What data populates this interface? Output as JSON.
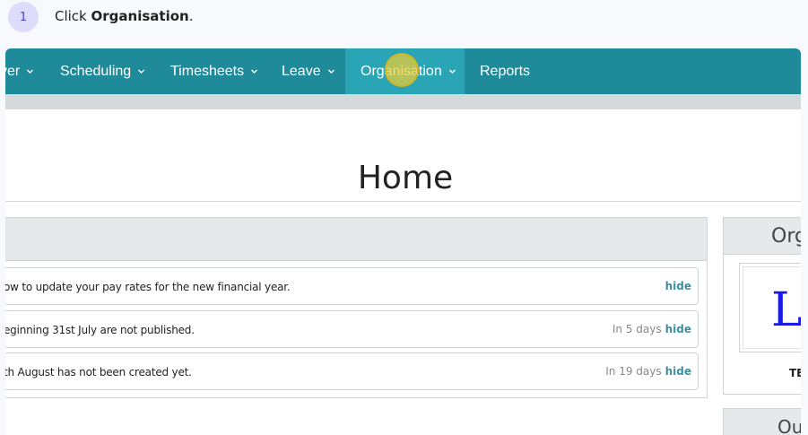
{
  "step": {
    "number": "1",
    "prefix": "Click ",
    "target": "Organisation",
    "suffix": "."
  },
  "nav": {
    "items": [
      {
        "label": "ver",
        "has_caret": true
      },
      {
        "label": "Scheduling",
        "has_caret": true
      },
      {
        "label": "Timesheets",
        "has_caret": true
      },
      {
        "label": "Leave",
        "has_caret": true
      },
      {
        "label": "Organisation",
        "has_caret": true,
        "active": true
      },
      {
        "label": "Reports",
        "has_caret": false
      }
    ],
    "caret_icon": "chevron-down-icon"
  },
  "page": {
    "title": "Home"
  },
  "notices": [
    {
      "text": "ow to update your pay rates for the new financial year.",
      "when": "",
      "action": "hide"
    },
    {
      "text": "eginning 31st July are not published.",
      "when": "In 5 days",
      "action": "hide"
    },
    {
      "text": "th August has not been created yet.",
      "when": "In 19 days",
      "action": "hide"
    }
  ],
  "side_panel": {
    "title": "Org",
    "logo_text": "L",
    "org_name": "TE"
  },
  "side_panel_2": {
    "title": "Ou"
  },
  "colors": {
    "navbar": "#1f8a99",
    "active_tab": "#2aa5b5",
    "click_highlight": "#ecce37",
    "link": "#3f8fa3",
    "step_badge": "#dedcfb"
  }
}
